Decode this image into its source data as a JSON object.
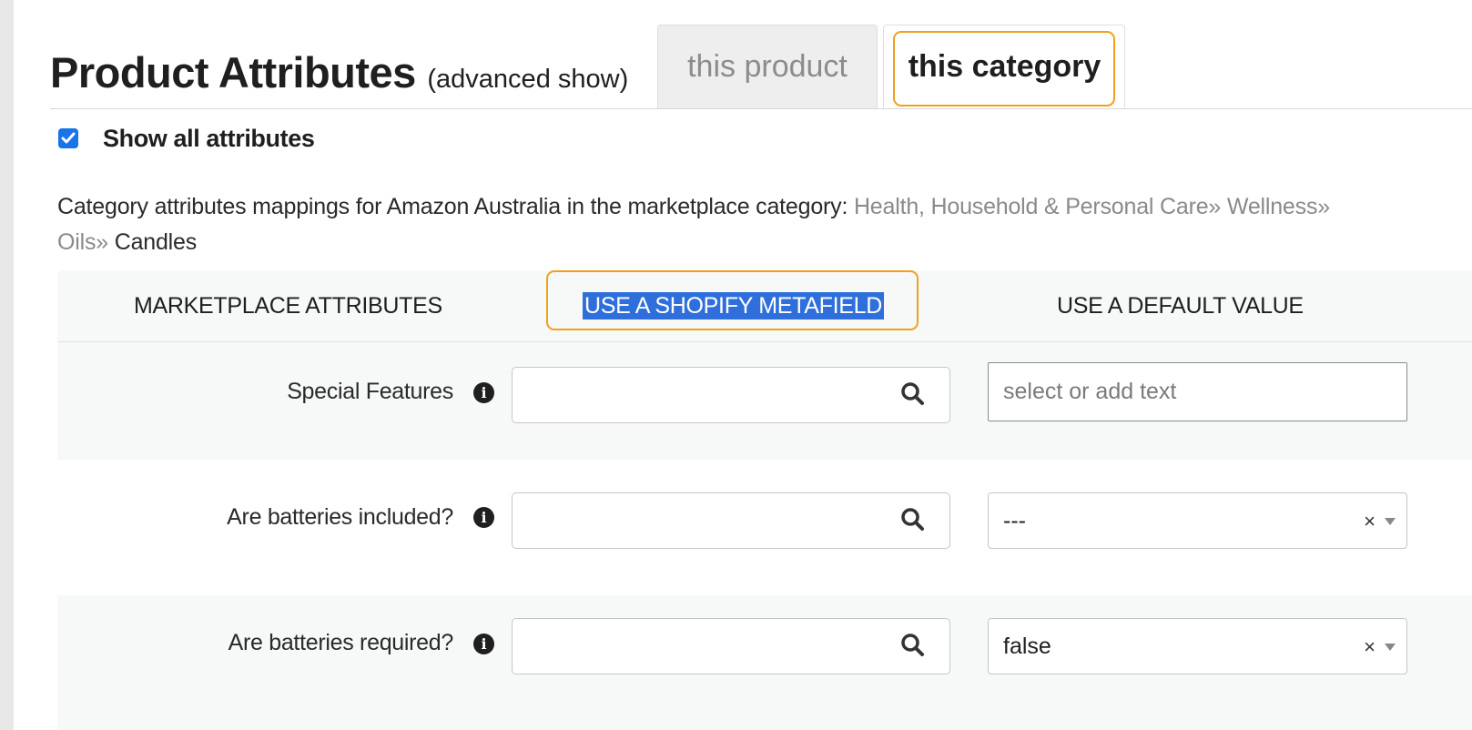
{
  "header": {
    "title": "Product Attributes",
    "subtitle": "(advanced show)"
  },
  "tabs": [
    {
      "label": "this product",
      "active": false
    },
    {
      "label": "this category",
      "active": true
    }
  ],
  "show_all": {
    "label": "Show all attributes",
    "checked": true
  },
  "description": {
    "text": "Category attributes mappings for Amazon Australia in the marketplace category:",
    "breadcrumb": [
      "Health, Household & Personal Care»",
      "Wellness»",
      "Oils»"
    ],
    "breadcrumb_last": "Candles"
  },
  "table": {
    "columns": [
      "MARKETPLACE ATTRIBUTES",
      "USE A SHOPIFY METAFIELD",
      "USE A DEFAULT VALUE"
    ],
    "rows": [
      {
        "label": "Special Features",
        "metafield": "",
        "default_value": "",
        "default_placeholder": "select or add text",
        "default_type": "text"
      },
      {
        "label": "Are batteries included?",
        "metafield": "",
        "default_value": "---",
        "default_type": "select"
      },
      {
        "label": "Are batteries required?",
        "metafield": "",
        "default_value": "false",
        "default_type": "select"
      }
    ]
  },
  "icons": {
    "info": "info-icon",
    "search": "search-icon",
    "clear": "clear-icon",
    "caret": "caret-down-icon"
  },
  "colors": {
    "highlight": "#f0a01c",
    "checkbox": "#1a73e8",
    "selection": "#2f6fdc"
  }
}
